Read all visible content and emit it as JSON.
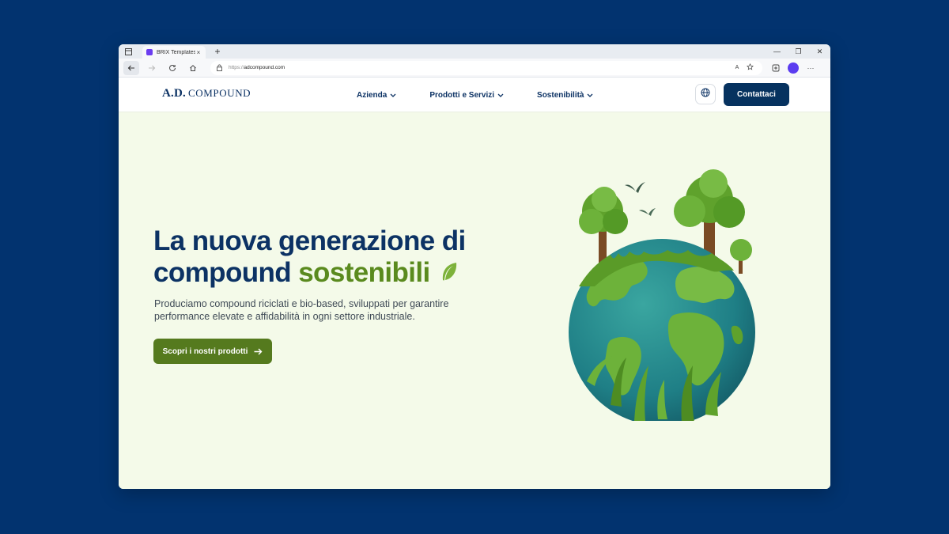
{
  "browser": {
    "tab_title": "BRIX Templates",
    "tab_close": "×",
    "new_tab": "+",
    "url_protocol": "https://",
    "url_host": "adcompound.com",
    "reader_label": "A",
    "window_minimize": "—",
    "window_restore": "❐",
    "window_close": "✕",
    "more": "···"
  },
  "site": {
    "logo_main": "A.D.",
    "logo_sub": "COMPOUND",
    "menu": [
      {
        "label": "Azienda"
      },
      {
        "label": "Prodotti e Servizi"
      },
      {
        "label": "Sostenibilità"
      }
    ],
    "cta_label": "Contattaci"
  },
  "hero": {
    "title_line1": "La nuova generazione di",
    "title_line2_start": "compound",
    "title_line2_green": "sostenibili",
    "subtitle": "Produciamo compound riciclati e bio-based, sviluppati per garantire performance elevate e affidabilità in ogni settore industriale.",
    "button_label": "Scopri i nostri prodotti"
  },
  "colors": {
    "page_bg": "#02336f",
    "navy": "#0c3264",
    "green_accent": "#5a8a1e",
    "hero_bg": "#f4fae9",
    "button_green": "#557a1e"
  }
}
